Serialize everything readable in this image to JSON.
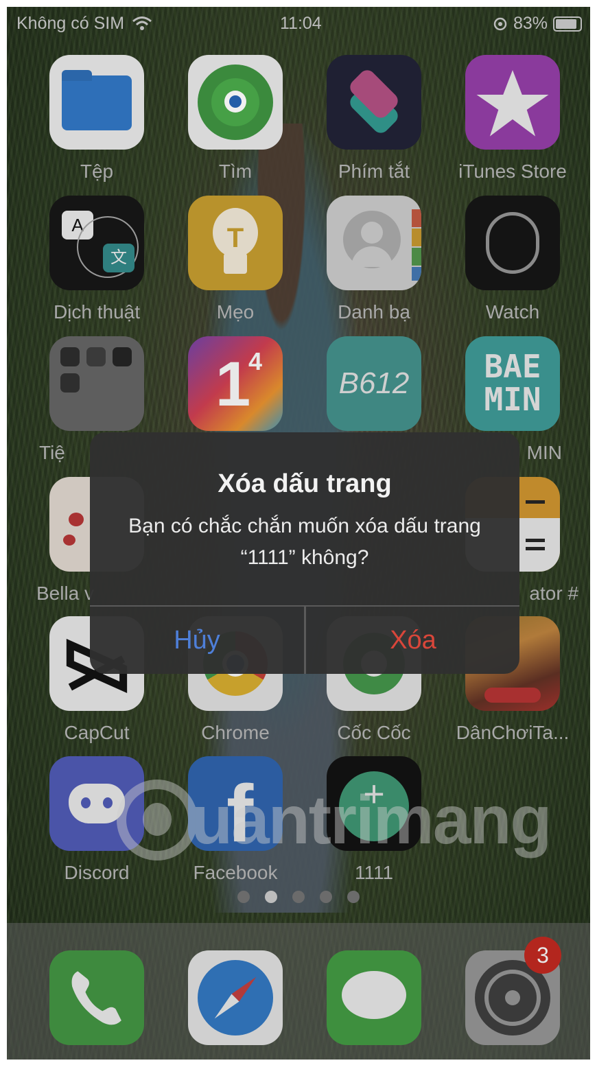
{
  "status_bar": {
    "carrier": "Không có SIM",
    "time": "11:04",
    "battery": "83%",
    "battery_level": 0.83
  },
  "apps": {
    "row1": [
      {
        "label": "Tệp",
        "icon": "files-icon"
      },
      {
        "label": "Tìm",
        "icon": "find-my-icon"
      },
      {
        "label": "Phím tắt",
        "icon": "shortcuts-icon"
      },
      {
        "label": "iTunes Store",
        "icon": "itunes-store-icon"
      }
    ],
    "row2": [
      {
        "label": "Dịch thuật",
        "icon": "translate-icon"
      },
      {
        "label": "Mẹo",
        "icon": "tips-icon"
      },
      {
        "label": "Danh bạ",
        "icon": "contacts-icon"
      },
      {
        "label": "Watch",
        "icon": "watch-icon"
      }
    ],
    "row3": [
      {
        "label": "Tiệ",
        "icon": "folder-icon"
      },
      {
        "label": "",
        "icon": "1-4-app-icon",
        "text": "1",
        "sup": "4"
      },
      {
        "label": "",
        "icon": "b612-icon",
        "text": "B612"
      },
      {
        "label": "MIN",
        "icon": "baemin-icon",
        "text": "BAE MIN"
      }
    ],
    "row4": [
      {
        "label": "Bella v",
        "icon": "bella-icon"
      },
      {
        "label": "ator #",
        "icon": "calculator-icon"
      }
    ],
    "row5": [
      {
        "label": "CapCut",
        "icon": "capcut-icon"
      },
      {
        "label": "Chrome",
        "icon": "chrome-icon"
      },
      {
        "label": "Cốc Cốc",
        "icon": "coccoc-icon"
      },
      {
        "label": "DânChơiTa...",
        "icon": "game-icon"
      }
    ],
    "row6": [
      {
        "label": "Discord",
        "icon": "discord-icon"
      },
      {
        "label": "Facebook",
        "icon": "facebook-icon",
        "text": "f"
      },
      {
        "label": "1111",
        "icon": "bookmark-1111-icon",
        "text": "+"
      }
    ]
  },
  "page_dots": {
    "count": 5,
    "active_index": 1
  },
  "dock": [
    {
      "name": "phone",
      "icon": "phone-icon"
    },
    {
      "name": "safari",
      "icon": "safari-icon"
    },
    {
      "name": "messages",
      "icon": "messages-icon"
    },
    {
      "name": "settings",
      "icon": "settings-icon",
      "badge": "3"
    }
  ],
  "watermark": {
    "text": "uantrimang"
  },
  "alert": {
    "title": "Xóa dấu trang",
    "message": "Bạn có chắc chắn muốn xóa dấu trang “1111” không?",
    "cancel_label": "Hủy",
    "delete_label": "Xóa"
  }
}
